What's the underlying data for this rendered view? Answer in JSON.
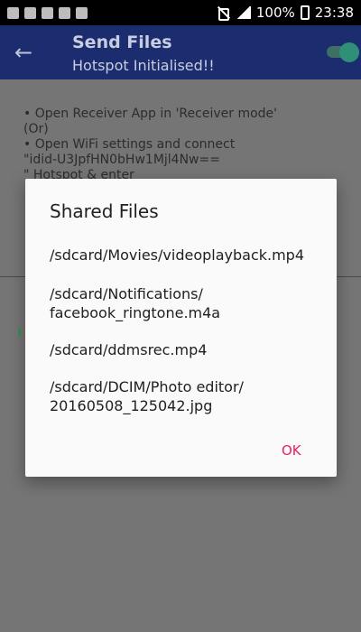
{
  "status_bar": {
    "battery": "100%",
    "time": "23:38"
  },
  "app_bar": {
    "back_icon": "arrow-left-icon",
    "title": "Send Files",
    "subtitle": "Hotspot Initialised!!",
    "toggle_on": true
  },
  "instructions": [
    "• Open Receiver App in 'Receiver mode'",
    "(Or)",
    "• Open WiFi settings and connect",
    "\"idid-U3JpfHN0bHw1Mjl4Nw==",
    "\" Hotspot & enter"
  ],
  "dialog": {
    "title": "Shared Files",
    "files": [
      "/sdcard/Movies/videoplayback.mp4",
      "/sdcard/Notifications/\nfacebook_ringtone.m4a",
      "/sdcard/ddmsrec.mp4",
      "/sdcard/DCIM/Photo editor/\n20160508_125042.jpg"
    ],
    "ok_label": "OK"
  },
  "colors": {
    "app_bar": "#1c2d6f",
    "accent": "#e91e63",
    "toggle": "#2f8f77"
  }
}
